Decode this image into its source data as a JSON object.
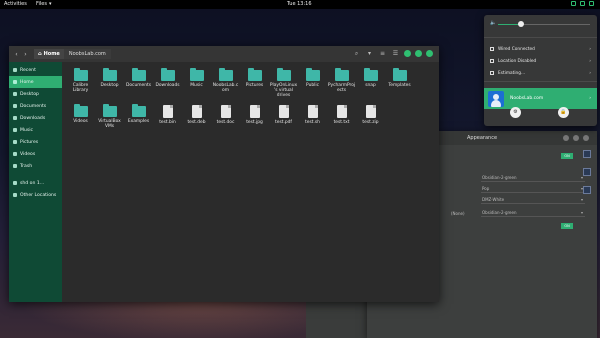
{
  "topbar": {
    "activities": "Activities",
    "app_menu": "Files",
    "app_menu_arrow": "▾",
    "clock": "Tue 13:16"
  },
  "files_window": {
    "breadcrumb_home": "Home",
    "breadcrumb_folder": "NoobsLab.com",
    "sidebar": [
      {
        "label": "Recent",
        "icon": "clock-icon",
        "active": false
      },
      {
        "label": "Home",
        "icon": "home-icon",
        "active": true
      },
      {
        "label": "Desktop",
        "icon": "desktop-icon",
        "active": false
      },
      {
        "label": "Documents",
        "icon": "documents-icon",
        "active": false
      },
      {
        "label": "Downloads",
        "icon": "downloads-icon",
        "active": false
      },
      {
        "label": "Music",
        "icon": "music-icon",
        "active": false
      },
      {
        "label": "Pictures",
        "icon": "pictures-icon",
        "active": false
      },
      {
        "label": "Videos",
        "icon": "videos-icon",
        "active": false
      },
      {
        "label": "Trash",
        "icon": "trash-icon",
        "active": false
      },
      {
        "label": "shd on 1...",
        "icon": "drive-icon",
        "active": false
      },
      {
        "label": "Other Locations",
        "icon": "plus-icon",
        "active": false
      }
    ],
    "items": [
      {
        "name": "Calibre Library",
        "type": "folder"
      },
      {
        "name": "Desktop",
        "type": "folder"
      },
      {
        "name": "Documents",
        "type": "folder"
      },
      {
        "name": "Downloads",
        "type": "folder"
      },
      {
        "name": "Music",
        "type": "folder"
      },
      {
        "name": "NoobsLab.com",
        "type": "folder"
      },
      {
        "name": "Pictures",
        "type": "folder"
      },
      {
        "name": "PlayOnLinux's virtual drives",
        "type": "folder"
      },
      {
        "name": "Public",
        "type": "folder"
      },
      {
        "name": "PycharmProjects",
        "type": "folder"
      },
      {
        "name": "snap",
        "type": "folder"
      },
      {
        "name": "Templates",
        "type": "folder"
      },
      {
        "name": "Videos",
        "type": "folder"
      },
      {
        "name": "VirtualBox VMs",
        "type": "folder"
      },
      {
        "name": "Examples",
        "type": "folder"
      },
      {
        "name": "test.bin",
        "type": "file"
      },
      {
        "name": "test.deb",
        "type": "file"
      },
      {
        "name": "test.doc",
        "type": "file"
      },
      {
        "name": "test.jpg",
        "type": "file"
      },
      {
        "name": "test.pdf",
        "type": "file"
      },
      {
        "name": "test.sh",
        "type": "file"
      },
      {
        "name": "test.txt",
        "type": "file"
      },
      {
        "name": "test.zip",
        "type": "file"
      }
    ]
  },
  "settings_window": {
    "title": "Appearance",
    "none_label": "(None)",
    "on_label": "ON",
    "selects": [
      "Obsidian-2-green",
      "Pop",
      "DMZ-White",
      "Obsidian-2-green"
    ]
  },
  "system_menu": {
    "volume": 0.25,
    "rows": [
      {
        "label": "Wired Connected",
        "icon": "network-icon"
      },
      {
        "label": "Location Disabled",
        "icon": "location-icon"
      },
      {
        "label": "Estimating...",
        "icon": "battery-icon"
      }
    ],
    "user": "NoobsLab.com",
    "chevron": "›",
    "bottom_buttons": [
      "settings-icon",
      "lock-icon"
    ]
  },
  "colors": {
    "accent": "#2fae72",
    "sidebar": "#0f4a35",
    "folder": "#3fb7a8"
  }
}
